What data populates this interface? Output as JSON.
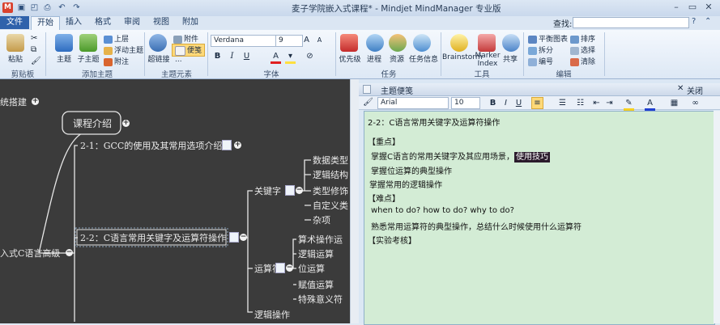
{
  "titlebar": {
    "app_icon": "M",
    "title": "麦子学院嵌入式课程* - Mindjet MindManager 专业版",
    "minimize": "–",
    "restore": "▭",
    "close": "✕"
  },
  "tabs": [
    "文件",
    "开始",
    "插入",
    "格式",
    "审阅",
    "视图",
    "附加"
  ],
  "search": {
    "label": "查找:",
    "value": ""
  },
  "ribbon": {
    "clipboard": {
      "paste": "粘贴",
      "group": "剪贴板"
    },
    "add_topic": {
      "topic": "主题",
      "subtopic": "子主题",
      "upper": "上层",
      "floating": "浮动主题",
      "callout": "附注",
      "group": "添加主题"
    },
    "topic_elements": {
      "link": "超链接",
      "attach": "附件",
      "note": "便笺",
      "more": "...",
      "group": "主题元素"
    },
    "font": {
      "family": "Verdana",
      "size": "9",
      "bold": "B",
      "italic": "I",
      "underline": "U",
      "group": "字体"
    },
    "task": {
      "priority": "优先级",
      "progress": "进程",
      "resource": "资源",
      "task_info": "任务信息",
      "group": "任务"
    },
    "tools": {
      "brainstorm": "Brainstorm",
      "marker_index": "Marker Index",
      "share": "共享",
      "group": "工具"
    },
    "edit": {
      "balance": "平衡图表",
      "split": "拆分",
      "number": "编号",
      "sort": "排序",
      "select": "选择",
      "clear": "清除",
      "group": "编辑"
    }
  },
  "map": {
    "left_cut_1": "统搭建",
    "course_intro": "课程介绍",
    "topic_1": "2-1：GCC的使用及其常用选项介绍",
    "topic_2": "2-2：C语言常用关键字及运算符操作",
    "root": "入式C语言高级",
    "keyword": "关键字",
    "kw_items": [
      "数据类型",
      "逻辑结构",
      "类型修饰",
      "自定义类",
      "杂项"
    ],
    "operator": "运算符",
    "op_items": [
      "算术操作运",
      "逻辑运算",
      "位运算",
      "赋值运算",
      "特殊意义符"
    ],
    "logic_op": "逻辑操作"
  },
  "notes": {
    "header": "主题便笺",
    "close": "关闭",
    "font": "Arial",
    "size": "10",
    "title": "2-2：C语言常用关键字及运算符操作",
    "lines": [
      "【重点】",
      "掌握C语言的常用关键字及其应用场景，",
      "掌握位运算的典型操作",
      "掌握常用的逻辑操作",
      "【难点】",
      "when to do? how to do?  why to do?",
      "熟悉常用运算符的典型操作，总结什么时候使用什么运算符",
      "【实验考核】"
    ],
    "highlight": "使用技巧"
  },
  "colors": {
    "map_bg": "#3b3b3b",
    "notes_bg": "#d3ecd5",
    "file_tab": "#2f62ab"
  }
}
